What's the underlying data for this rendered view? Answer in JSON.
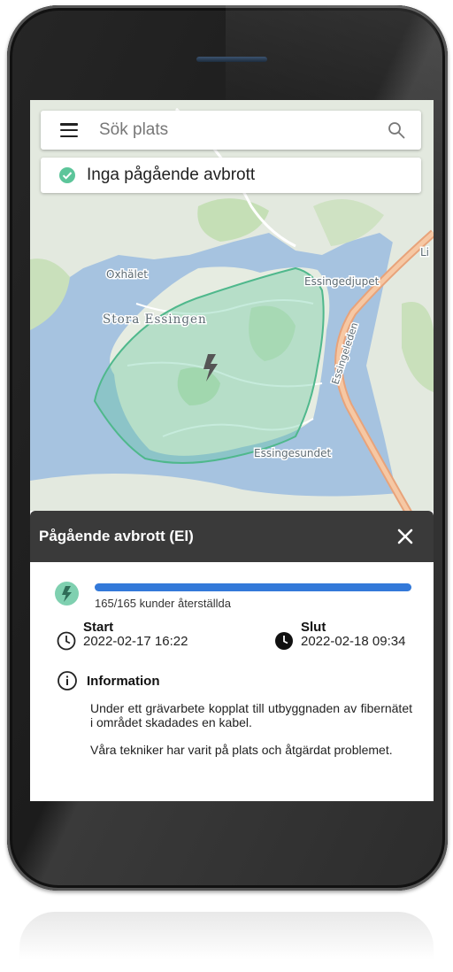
{
  "search": {
    "placeholder": "Sök plats"
  },
  "status": {
    "text": "Inga pågående avbrott",
    "color": "#5cc59a"
  },
  "map": {
    "labels": {
      "oxhalet": "Oxhälet",
      "stora_essingen": "Stora Essingen",
      "essingedjupet": "Essingedjupet",
      "essingeleden": "Essingeleden",
      "essingesundet": "Essingesundet",
      "edge_letter": "Li"
    },
    "area_color": "#5cc59a",
    "icon": "bolt-icon"
  },
  "panel": {
    "title": "Pågående avbrott (El)",
    "progress": {
      "restored": 165,
      "total": 165,
      "fraction": 1.0,
      "label": "165/165 kunder återställda",
      "color": "#3379d9"
    },
    "start": {
      "label": "Start",
      "value": "2022-02-17 16:22"
    },
    "end": {
      "label": "Slut",
      "value": "2022-02-18 09:34"
    },
    "info": {
      "heading": "Information",
      "paragraphs": [
        "Under ett grävarbete kopplat till utbyggnaden av fibernätet i området skadades en kabel.",
        "Våra tekniker har varit på plats och åtgärdat problemet."
      ]
    }
  }
}
